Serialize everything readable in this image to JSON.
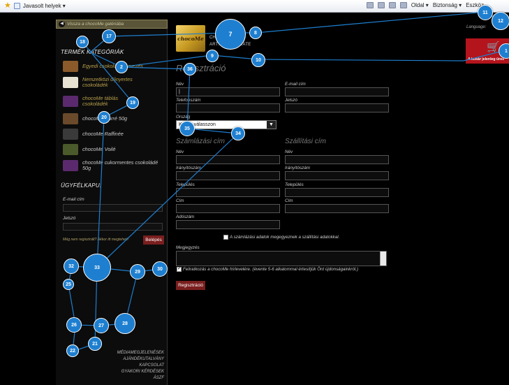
{
  "browser": {
    "favorites_label": "Javasolt helyek ▾",
    "menu": [
      "Oldal ▾",
      "Biztonság ▾",
      "Eszköz"
    ]
  },
  "sidebar": {
    "back_link": "Vissza a chocoMe galériába",
    "categories_title": "TERMÉK KATEGÓRIÁK",
    "categories": [
      {
        "label": "Egyedi csokoládé tervezés",
        "color": "#8b5a2b"
      },
      {
        "label": "Nemzetközi díjnyertes csokoládék",
        "color": "#e8e2d2"
      },
      {
        "label": "chocoMe táblás csokoládék",
        "color": "#5b2a6e"
      },
      {
        "label": "chocoMe Carré 50g",
        "color": "#6a4a2a"
      },
      {
        "label": "chocoMe Raffinée",
        "color": "#3a3a3a"
      },
      {
        "label": "chocoMe Voilé",
        "color": "#4a5a2a"
      },
      {
        "label": "chocoMe cukormentes csokoládé 50g",
        "color": "#5b2a6e"
      }
    ],
    "client_title": "ÜGYFÉLKAPU:",
    "email_label": "E-mail cím",
    "password_label": "Jelszó",
    "register_hint": "Még nem regisztrált? Akkor itt megteheti!",
    "login_button": "Belépés",
    "footer_links": [
      "MÉDIAMEGJELENÉSEK",
      "AJÁNDÉKUTALVÁNY",
      "KAPCSOLAT",
      "GYAKORI KÉRDÉSEK",
      "ÁSZF"
    ]
  },
  "header": {
    "logo_text": "chocoMe",
    "tagline_a": "CHOCOLATE",
    "tagline_b": "ART... CHOCOLATE",
    "language_label": "Language:",
    "cart_label": "A kosár jelenleg üres"
  },
  "form": {
    "title": "Regisztráció",
    "name_label": "Név",
    "email_label": "E-mail cím",
    "phone_label": "Telefonszám",
    "password_label": "Jelszó",
    "country_label": "Ország",
    "country_value": "Kérjük válasszon",
    "billing_title": "Számlázási cím",
    "shipping_title": "Szállítási cím",
    "b_name": "Név",
    "b_zip": "Irányítószám",
    "b_city": "Település",
    "b_address": "Cím",
    "tax_label": "Adószám",
    "s_name": "Név",
    "s_zip": "Irányítószám",
    "s_city": "Település",
    "s_address": "Cím",
    "same_address": "A számlázási adatok megegyeznek a szállítási adatokkal.",
    "comment_label": "Megjegyzés",
    "newsletter": "Feliratkozás a chocoMe hírlevelére. (évente 5-6 alkalommal értesítjük Önt újdonságainkról.)",
    "submit": "Regisztráció"
  },
  "heatmap_markers": [
    "1",
    "2",
    "7",
    "8",
    "9",
    "10",
    "11",
    "12",
    "17",
    "18",
    "19",
    "20",
    "21",
    "22",
    "25",
    "26",
    "27",
    "28",
    "29",
    "30",
    "32",
    "33",
    "34",
    "35",
    "36"
  ]
}
